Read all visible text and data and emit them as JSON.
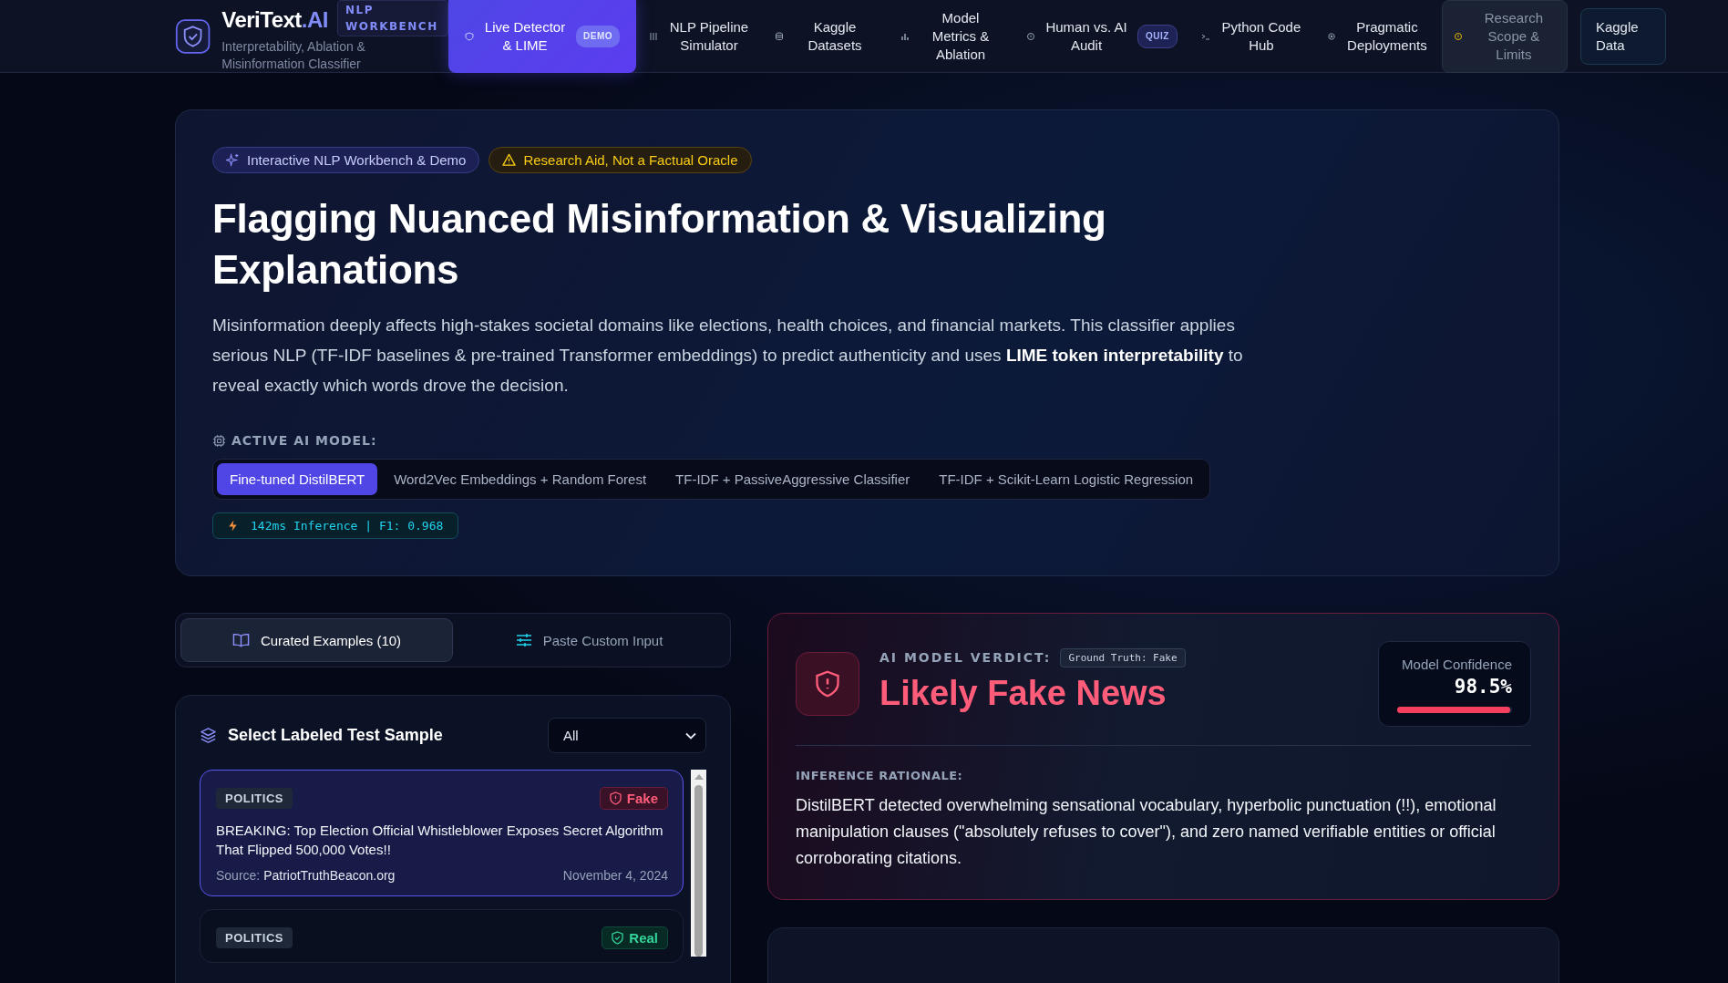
{
  "brand": {
    "name": "VeriText",
    "suffix": ".AI",
    "badge": "NLP WORKBENCH",
    "subtitle": "Interpretability, Ablation & Misinformation Classifier"
  },
  "nav": [
    {
      "label": "Live Detector & LIME",
      "badge": "DEMO",
      "selected": true,
      "kind": "page"
    },
    {
      "label": "NLP Pipeline Simulator",
      "selected": false,
      "kind": "page"
    },
    {
      "label": "Kaggle Datasets",
      "selected": false,
      "kind": "page"
    },
    {
      "label": "Model Metrics & Ablation",
      "selected": false,
      "kind": "page"
    },
    {
      "label": "Human vs. AI Audit",
      "badge": "QUIZ",
      "selected": false,
      "kind": "page"
    },
    {
      "label": "Python Code Hub",
      "selected": false,
      "kind": "page"
    },
    {
      "label": "Pragmatic Deployments",
      "selected": false,
      "kind": "page"
    },
    {
      "label": "Research Scope & Limits",
      "selected": false,
      "kind": "scope"
    }
  ],
  "external_link": {
    "label": "Kaggle Data"
  },
  "hero": {
    "tags": [
      {
        "label": "Interactive NLP Workbench & Demo",
        "kind": "info"
      },
      {
        "label": "Research Aid, Not a Factual Oracle",
        "kind": "warning"
      }
    ],
    "title": "Flagging Nuanced Misinformation & Visualizing Explanations",
    "description": "Misinformation deeply affects high-stakes societal domains like elections, health choices, and financial markets. This classifier applies serious NLP (TF-IDF baselines & pre-trained Transformer embeddings) to predict authenticity and uses **LIME token interpretability** to reveal exactly which words drove the decision.",
    "model_label": "ACTIVE AI MODEL:",
    "models": [
      {
        "label": "Fine-tuned DistilBERT",
        "selected": true
      },
      {
        "label": "Word2Vec Embeddings + Random Forest",
        "selected": false
      },
      {
        "label": "TF-IDF + PassiveAggressive Classifier",
        "selected": false
      },
      {
        "label": "TF-IDF + Scikit-Learn Logistic Regression",
        "selected": false
      }
    ],
    "stats": "142ms Inference | F1: 0.968"
  },
  "input_tabs": [
    {
      "label": "Curated Examples (10)",
      "selected": true
    },
    {
      "label": "Paste Custom Input",
      "selected": false
    }
  ],
  "sample_panel": {
    "title": "Select Labeled Test Sample",
    "filter": "All",
    "samples": [
      {
        "category": "POLITICS",
        "label": "Fake",
        "kind": "fake",
        "selected": true,
        "headline": "BREAKING: Top Election Official Whistleblower Exposes Secret Algorithm That Flipped 500,000 Votes!!",
        "source_label": "Source:",
        "source": "PatriotTruthBeacon.org",
        "date": "November 4, 2024"
      },
      {
        "category": "POLITICS",
        "label": "Real",
        "kind": "real",
        "selected": false
      }
    ]
  },
  "verdict": {
    "kind": "fake",
    "label": "AI MODEL VERDICT:",
    "ground_truth": "Ground Truth: Fake",
    "title": "Likely Fake News",
    "confidence_label": "Model Confidence",
    "confidence": "98.5%",
    "level": 0.985,
    "rationale_label": "INFERENCE RATIONALE:",
    "rationale": "DistilBERT detected overwhelming sensational vocabulary, hyperbolic punctuation (!!), emotional manipulation clauses (\"absolutely refuses to cover\"), and zero named verifiable entities or official corroborating citations."
  }
}
